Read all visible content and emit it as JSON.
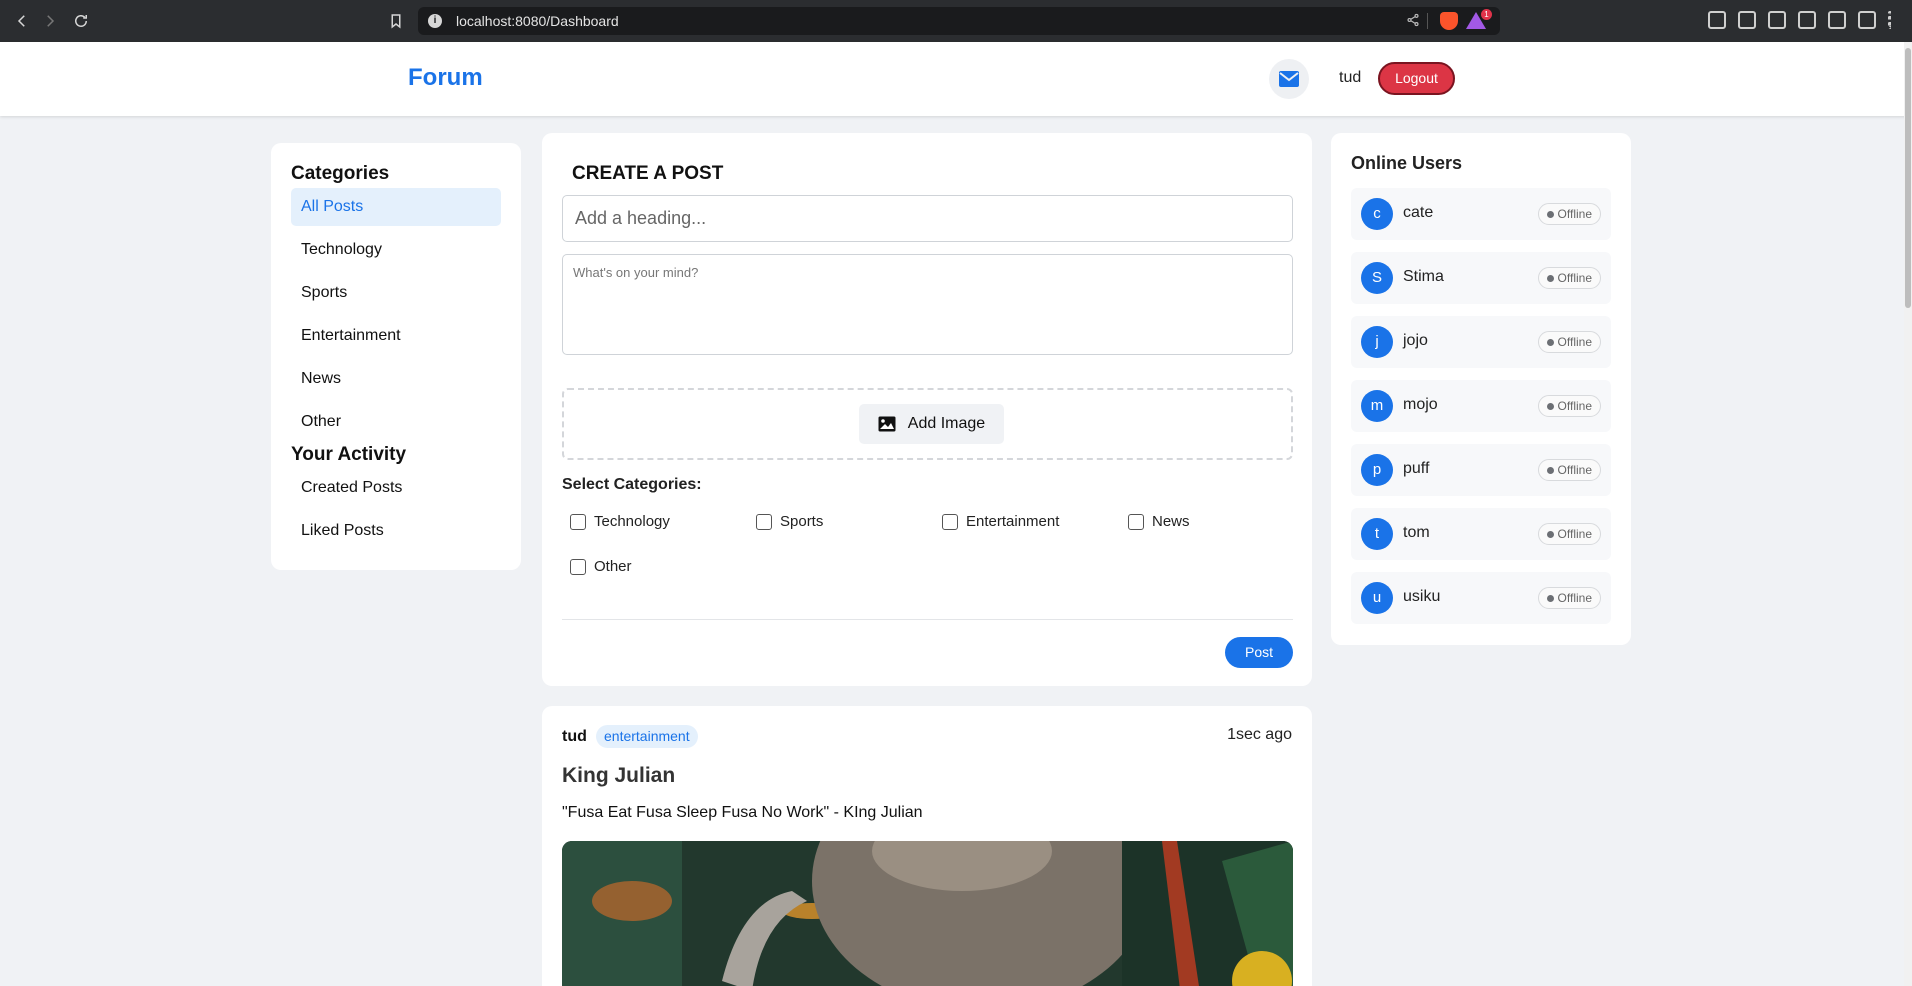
{
  "browser": {
    "url": "localhost:8080/Dashboard",
    "extension_badge": "1"
  },
  "header": {
    "logo": "Forum",
    "username": "tud",
    "logout_label": "Logout",
    "accent": "#1a73e8",
    "danger": "#dc3545"
  },
  "sidebar": {
    "categories_title": "Categories",
    "categories": [
      "All Posts",
      "Technology",
      "Sports",
      "Entertainment",
      "News",
      "Other"
    ],
    "activity_title": "Your Activity",
    "activity": [
      "Created Posts",
      "Liked Posts"
    ]
  },
  "create_post": {
    "title": "CREATE A POST",
    "heading_placeholder": "Add a heading...",
    "body_placeholder": "What's on your mind?",
    "add_image_label": "Add Image",
    "select_categories_label": "Select Categories:",
    "categories": [
      "Technology",
      "Sports",
      "Entertainment",
      "News",
      "Other"
    ],
    "post_label": "Post"
  },
  "online_users": {
    "title": "Online Users",
    "status_label": "Offline",
    "users": [
      {
        "initial": "c",
        "name": "cate"
      },
      {
        "initial": "S",
        "name": "Stima"
      },
      {
        "initial": "j",
        "name": "jojo"
      },
      {
        "initial": "m",
        "name": "mojo"
      },
      {
        "initial": "p",
        "name": "puff"
      },
      {
        "initial": "t",
        "name": "tom"
      },
      {
        "initial": "u",
        "name": "usiku"
      }
    ]
  },
  "post": {
    "author": "tud",
    "tag": "entertainment",
    "time": "1sec ago",
    "title": "King Julian",
    "text": "\"Fusa Eat Fusa Sleep Fusa No Work\" - KIng Julian"
  }
}
